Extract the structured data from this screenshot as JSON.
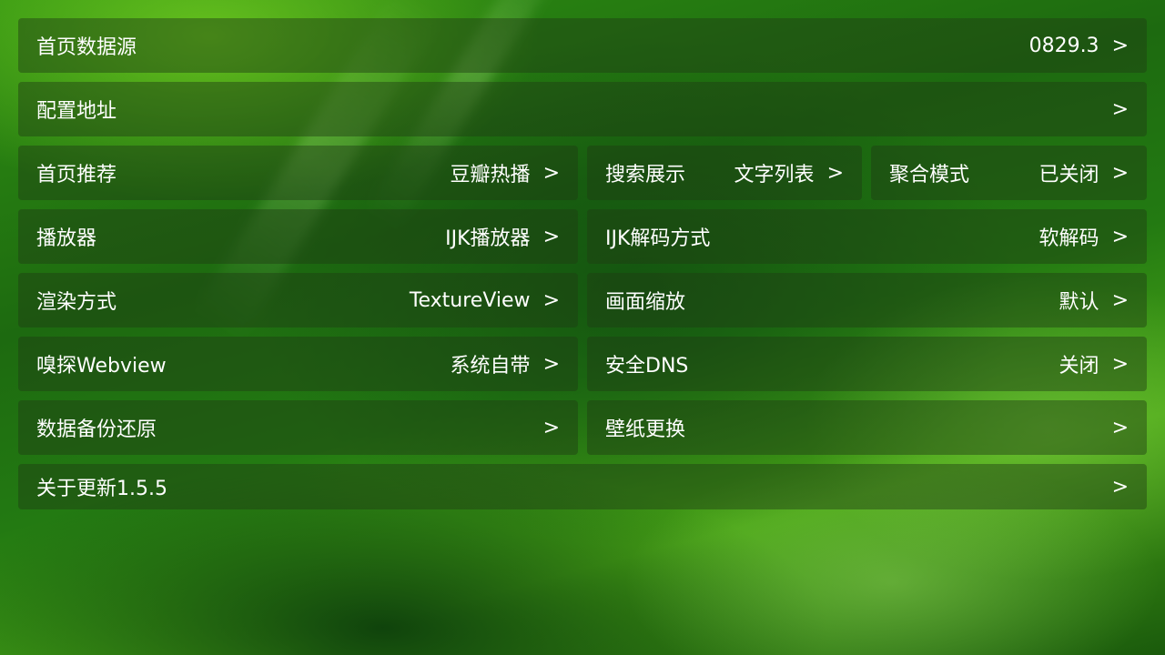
{
  "settings": {
    "home_source": {
      "label": "首页数据源",
      "value": "0829.3"
    },
    "config_url": {
      "label": "配置地址",
      "value": ""
    },
    "home_recommend": {
      "label": "首页推荐",
      "value": "豆瓣热播"
    },
    "search_display": {
      "label": "搜索展示",
      "value": "文字列表"
    },
    "aggregate_mode": {
      "label": "聚合模式",
      "value": "已关闭"
    },
    "player": {
      "label": "播放器",
      "value": "IJK播放器"
    },
    "ijk_decode": {
      "label": "IJK解码方式",
      "value": "软解码"
    },
    "render_mode": {
      "label": "渲染方式",
      "value": "TextureView"
    },
    "screen_scale": {
      "label": "画面缩放",
      "value": "默认"
    },
    "sniff_webview": {
      "label": "嗅探Webview",
      "value": "系统自带"
    },
    "secure_dns": {
      "label": "安全DNS",
      "value": "关闭"
    },
    "backup_restore": {
      "label": "数据备份还原",
      "value": ""
    },
    "wallpaper": {
      "label": "壁纸更换",
      "value": ""
    },
    "about_update": {
      "label": "关于更新1.5.5",
      "value": ""
    }
  },
  "chevron": ">",
  "colors": {
    "row_bg": "rgba(30,60,20,0.45)",
    "text": "#ffffff"
  }
}
